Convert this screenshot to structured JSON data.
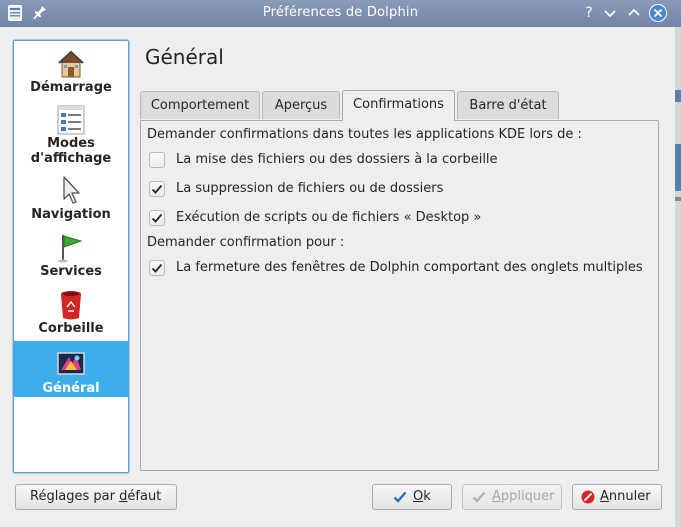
{
  "window": {
    "title": "Préférences de Dolphin",
    "help_button": "?",
    "icons": [
      "app-icon",
      "pin-icon",
      "help-icon",
      "minimize-icon",
      "maximize-icon",
      "close-icon"
    ]
  },
  "sidebar": {
    "items": [
      {
        "label": "Démarrage",
        "icon": "house-icon"
      },
      {
        "label": "Modes\nd'affichage",
        "icon": "view-modes-icon"
      },
      {
        "label": "Navigation",
        "icon": "cursor-icon"
      },
      {
        "label": "Services",
        "icon": "flag-icon"
      },
      {
        "label": "Corbeille",
        "icon": "trash-icon"
      },
      {
        "label": "Général",
        "icon": "general-settings-icon"
      }
    ],
    "selected": "Général"
  },
  "page": {
    "heading": "Général",
    "tabs": [
      {
        "label": "Comportement"
      },
      {
        "label": "Aperçus"
      },
      {
        "label": "Confirmations"
      },
      {
        "label": "Barre d'état"
      }
    ],
    "active_tab": "Confirmations",
    "confirmations": {
      "section1_label": "Demander confirmations dans toutes les applications KDE lors de :",
      "section1_items": [
        {
          "label": "La mise des fichiers ou des dossiers à la corbeille",
          "checked": false
        },
        {
          "label": "La suppression de fichiers ou de dossiers",
          "checked": true
        },
        {
          "label": "Exécution de scripts ou de fichiers « Desktop »",
          "checked": true
        }
      ],
      "section2_label": "Demander confirmation pour :",
      "section2_items": [
        {
          "label": "La fermeture des fenêtres de Dolphin comportant des onglets multiples",
          "checked": true
        }
      ]
    }
  },
  "buttons": {
    "defaults": {
      "label": "Réglages par défaut",
      "mnemonic": "d"
    },
    "ok": {
      "label": "Ok",
      "mnemonic": "O",
      "icon": "checkmark-icon"
    },
    "apply": {
      "label": "Appliquer",
      "mnemonic": "A",
      "icon": "checkmark-icon",
      "enabled": false
    },
    "cancel": {
      "label": "Annuler",
      "mnemonic": "A",
      "icon": "cancel-icon"
    }
  },
  "colors": {
    "titlebar": "#7f90af",
    "selection": "#3daee9",
    "focus_border": "#5fa0d8",
    "checkmark": "#232627",
    "close_button": "#4d86c9"
  }
}
